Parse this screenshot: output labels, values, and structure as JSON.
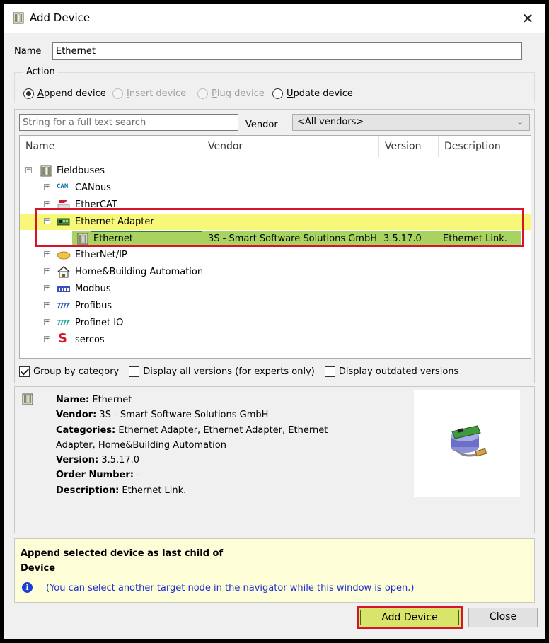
{
  "window": {
    "title": "Add Device",
    "close_glyph": "✕"
  },
  "name_field": {
    "label": "Name",
    "value": "Ethernet"
  },
  "action": {
    "legend": "Action",
    "options": [
      {
        "pre": "",
        "accel": "A",
        "post": "ppend device",
        "state": "checked"
      },
      {
        "pre": "",
        "accel": "I",
        "post": "nsert device",
        "state": "disabled"
      },
      {
        "pre": "",
        "accel": "P",
        "post": "lug device",
        "state": "disabled"
      },
      {
        "pre": "",
        "accel": "U",
        "post": "pdate device",
        "state": "enabled"
      }
    ]
  },
  "search": {
    "placeholder": "String for a full text search",
    "value": ""
  },
  "vendor": {
    "label": "Vendor",
    "selected": "<All vendors>"
  },
  "tree": {
    "columns": [
      "Name",
      "Vendor",
      "Version",
      "Description"
    ],
    "root": {
      "label": "Fieldbuses",
      "icon": "device-rack-icon"
    },
    "categories": [
      {
        "label": "CANbus",
        "icon": "can-icon",
        "badge": "CAN"
      },
      {
        "label": "EtherCAT",
        "icon": "ethercat-icon"
      },
      {
        "label": "Ethernet Adapter",
        "icon": "network-card-icon",
        "expanded": true
      },
      {
        "label": "EtherNet/IP",
        "icon": "ethernetip-icon"
      },
      {
        "label": "Home&Building Automation",
        "icon": "house-icon"
      },
      {
        "label": "Modbus",
        "icon": "modbus-icon"
      },
      {
        "label": "Profibus",
        "icon": "profibus-icon"
      },
      {
        "label": "Profinet IO",
        "icon": "profinet-icon"
      },
      {
        "label": "sercos",
        "icon": "sercos-icon",
        "badge": "S"
      }
    ],
    "selected_device": {
      "name": "Ethernet",
      "vendor": "3S - Smart Software Solutions GmbH",
      "version": "3.5.17.0",
      "description": "Ethernet Link."
    }
  },
  "checkboxes": [
    {
      "label": "Group by category",
      "checked": true
    },
    {
      "label": "Display all versions (for experts only)",
      "checked": false
    },
    {
      "label": "Display outdated versions",
      "checked": false
    }
  ],
  "info": {
    "name_label": "Name:",
    "name": "Ethernet",
    "vendor_label": "Vendor:",
    "vendor": "3S - Smart Software Solutions GmbH",
    "categories_label": "Categories:",
    "categories": "Ethernet Adapter, Ethernet Adapter, Ethernet Adapter, Home&Building Automation",
    "version_label": "Version:",
    "version": "3.5.17.0",
    "order_label": "Order Number:",
    "order": "-",
    "description_label": "Description:",
    "description": "Ethernet Link."
  },
  "hint": {
    "title": "Append selected device as last child of Device",
    "note": "(You can select another target node in the navigator while this window is open.)"
  },
  "buttons": {
    "add": "Add Device",
    "close": "Close"
  },
  "colors": {
    "selection_category": "#f7f77a",
    "selection_device": "#a9d361",
    "highlight_frame": "#d7142a",
    "hint_text": "#1c2fd0"
  }
}
